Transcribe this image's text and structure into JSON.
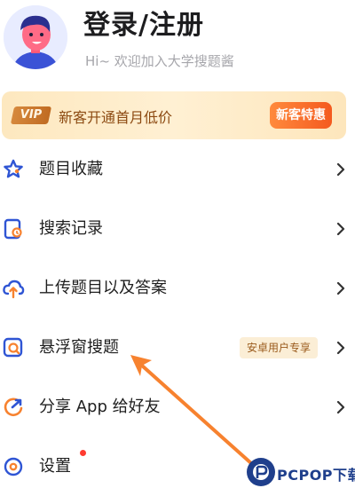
{
  "header": {
    "title": "登录/注册",
    "subtitle": "Hi~ 欢迎加入大学搜题酱"
  },
  "vip_banner": {
    "badge": "VIP",
    "text": "新客开通首月低价",
    "button": "新客特惠"
  },
  "menu": {
    "items": [
      {
        "label": "题目收藏",
        "icon": "star-icon"
      },
      {
        "label": "搜索记录",
        "icon": "search-history-icon"
      },
      {
        "label": "上传题目以及答案",
        "icon": "upload-icon"
      },
      {
        "label": "悬浮窗搜题",
        "icon": "floating-search-icon",
        "tag": "安卓用户专享"
      },
      {
        "label": "分享 App 给好友",
        "icon": "share-icon"
      },
      {
        "label": "设置",
        "icon": "settings-icon",
        "has_dot": true
      }
    ]
  },
  "watermark": {
    "text": "PCPOP下载"
  },
  "colors": {
    "accent_blue": "#2f55d4",
    "accent_orange": "#f7822f",
    "vip_text": "#8c4a12",
    "notice_dot": "#ff3b30"
  }
}
